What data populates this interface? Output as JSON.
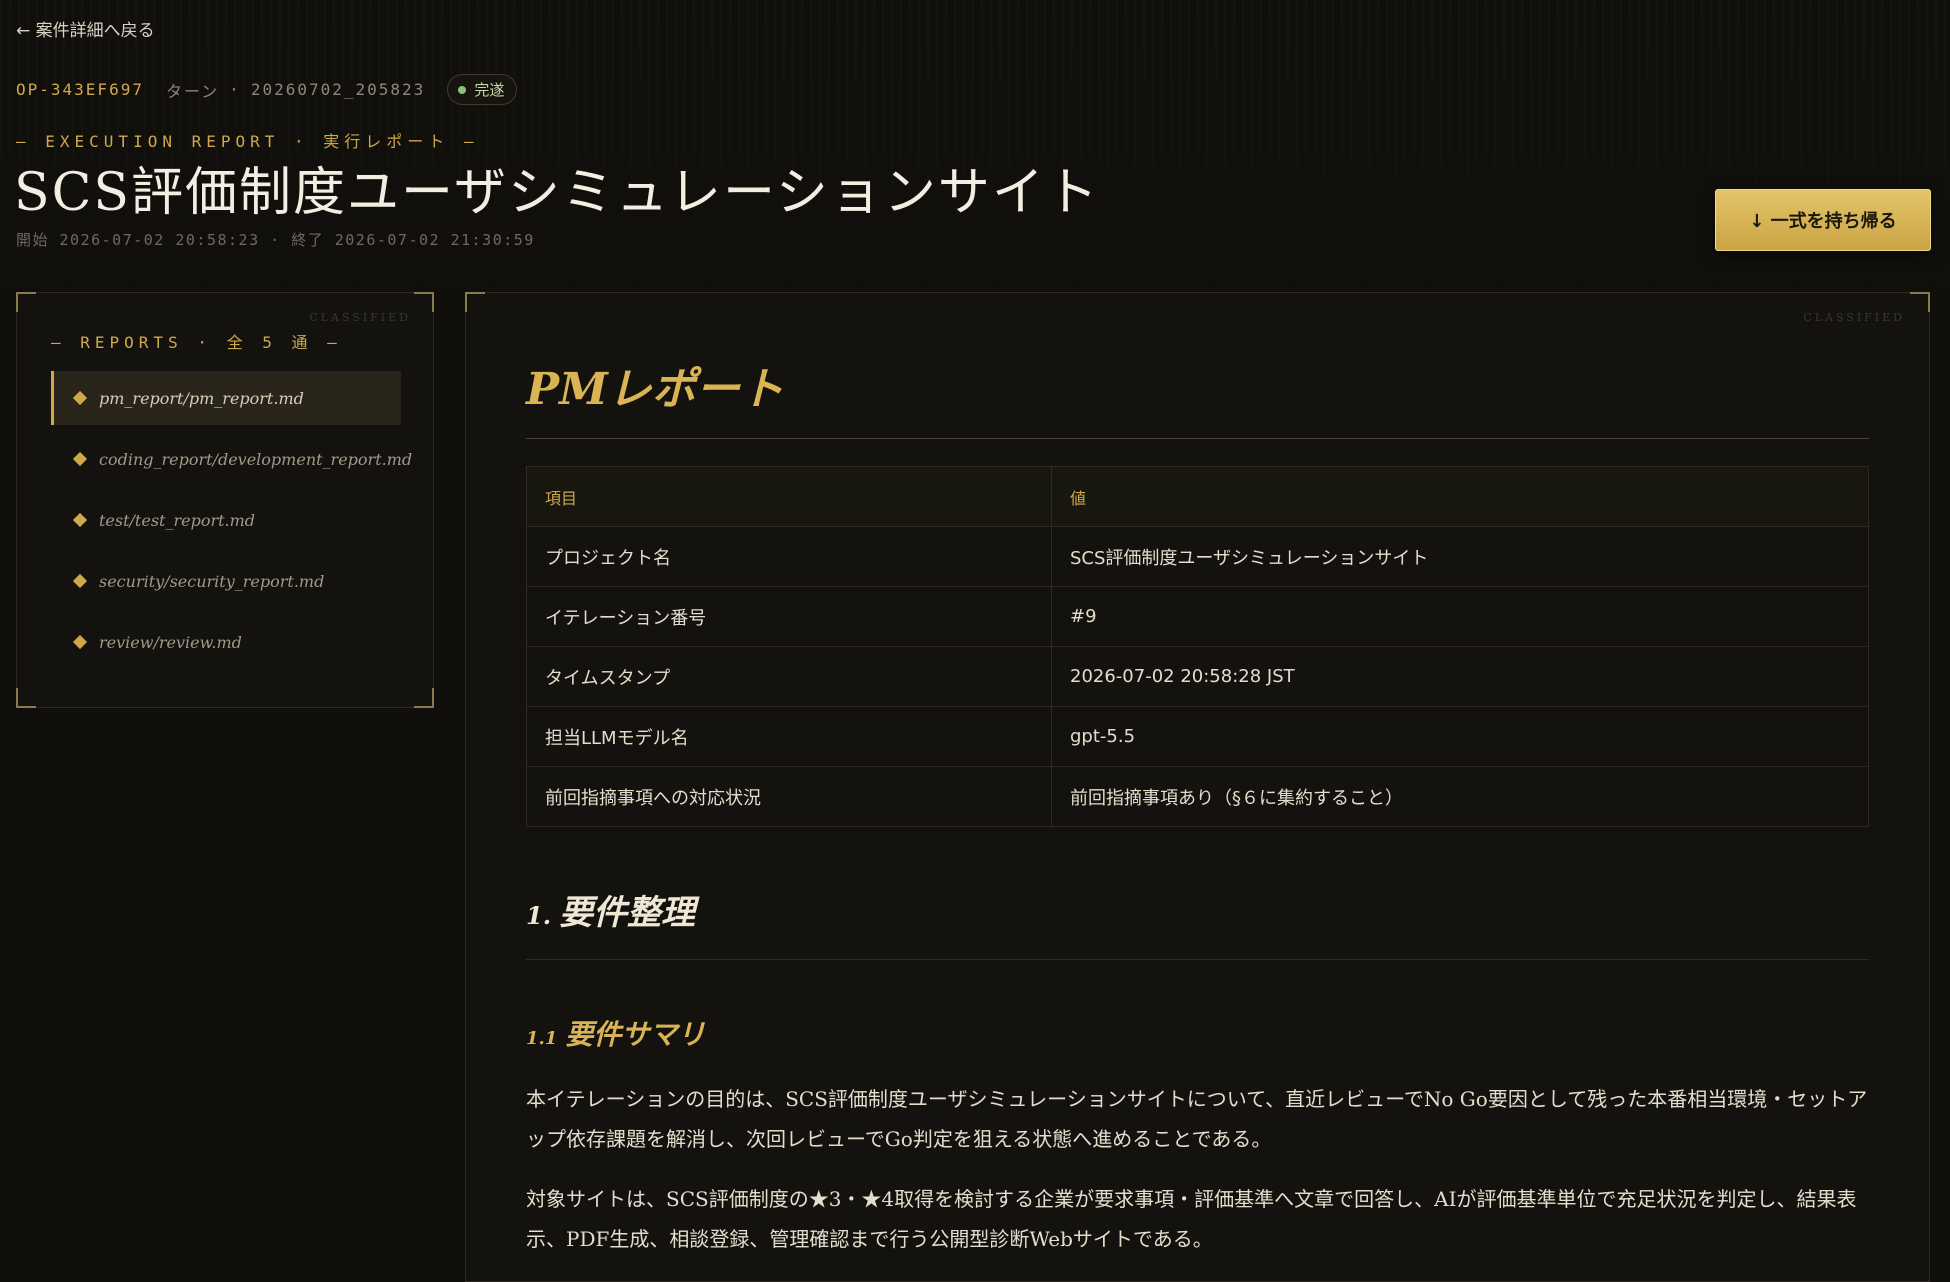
{
  "nav": {
    "back_label": "← 案件詳細へ戻る"
  },
  "header": {
    "op_id": "OP-343EF697",
    "turn_label": "ターン",
    "separator": "·",
    "turn_id": "20260702_205823",
    "status": "完遂",
    "eyebrow": "— EXECUTION REPORT · 実行レポート —",
    "title": "SCS評価制度ユーザシミュレーションサイト",
    "timing": "開始 2026-07-02 20:58:23 · 終了 2026-07-02 21:30:59",
    "download_label": "↓ 一式を持ち帰る"
  },
  "sidebar": {
    "watermark": "CLASSIFIED",
    "heading": "— REPORTS · 全 5 通 —",
    "items": [
      {
        "label": "pm_report/pm_report.md"
      },
      {
        "label": "coding_report/development_report.md"
      },
      {
        "label": "test/test_report.md"
      },
      {
        "label": "security/security_report.md"
      },
      {
        "label": "review/review.md"
      }
    ]
  },
  "document": {
    "watermark": "CLASSIFIED",
    "title": "PMレポート",
    "table": {
      "headers": [
        "項目",
        "値"
      ],
      "rows": [
        [
          "プロジェクト名",
          "SCS評価制度ユーザシミュレーションサイト"
        ],
        [
          "イテレーション番号",
          "#9"
        ],
        [
          "タイムスタンプ",
          "2026-07-02 20:58:28 JST"
        ],
        [
          "担当LLMモデル名",
          "gpt-5.5"
        ],
        [
          "前回指摘事項への対応状況",
          "前回指摘事項あり（§６に集約すること）"
        ]
      ]
    },
    "section1": {
      "number": "1.",
      "title": "要件整理"
    },
    "section1_1": {
      "number": "1.1",
      "title": "要件サマリ"
    },
    "paragraphs": [
      "本イテレーションの目的は、SCS評価制度ユーザシミュレーションサイトについて、直近レビューでNo Go要因として残った本番相当環境・セットアップ依存課題を解消し、次回レビューでGo判定を狙える状態へ進めることである。",
      "対象サイトは、SCS評価制度の★3・★4取得を検討する企業が要求事項・評価基準へ文章で回答し、AIが評価基準単位で充足状況を判定し、結果表示、PDF生成、相談登録、管理確認まで行う公開型診断Webサイトである。"
    ]
  }
}
